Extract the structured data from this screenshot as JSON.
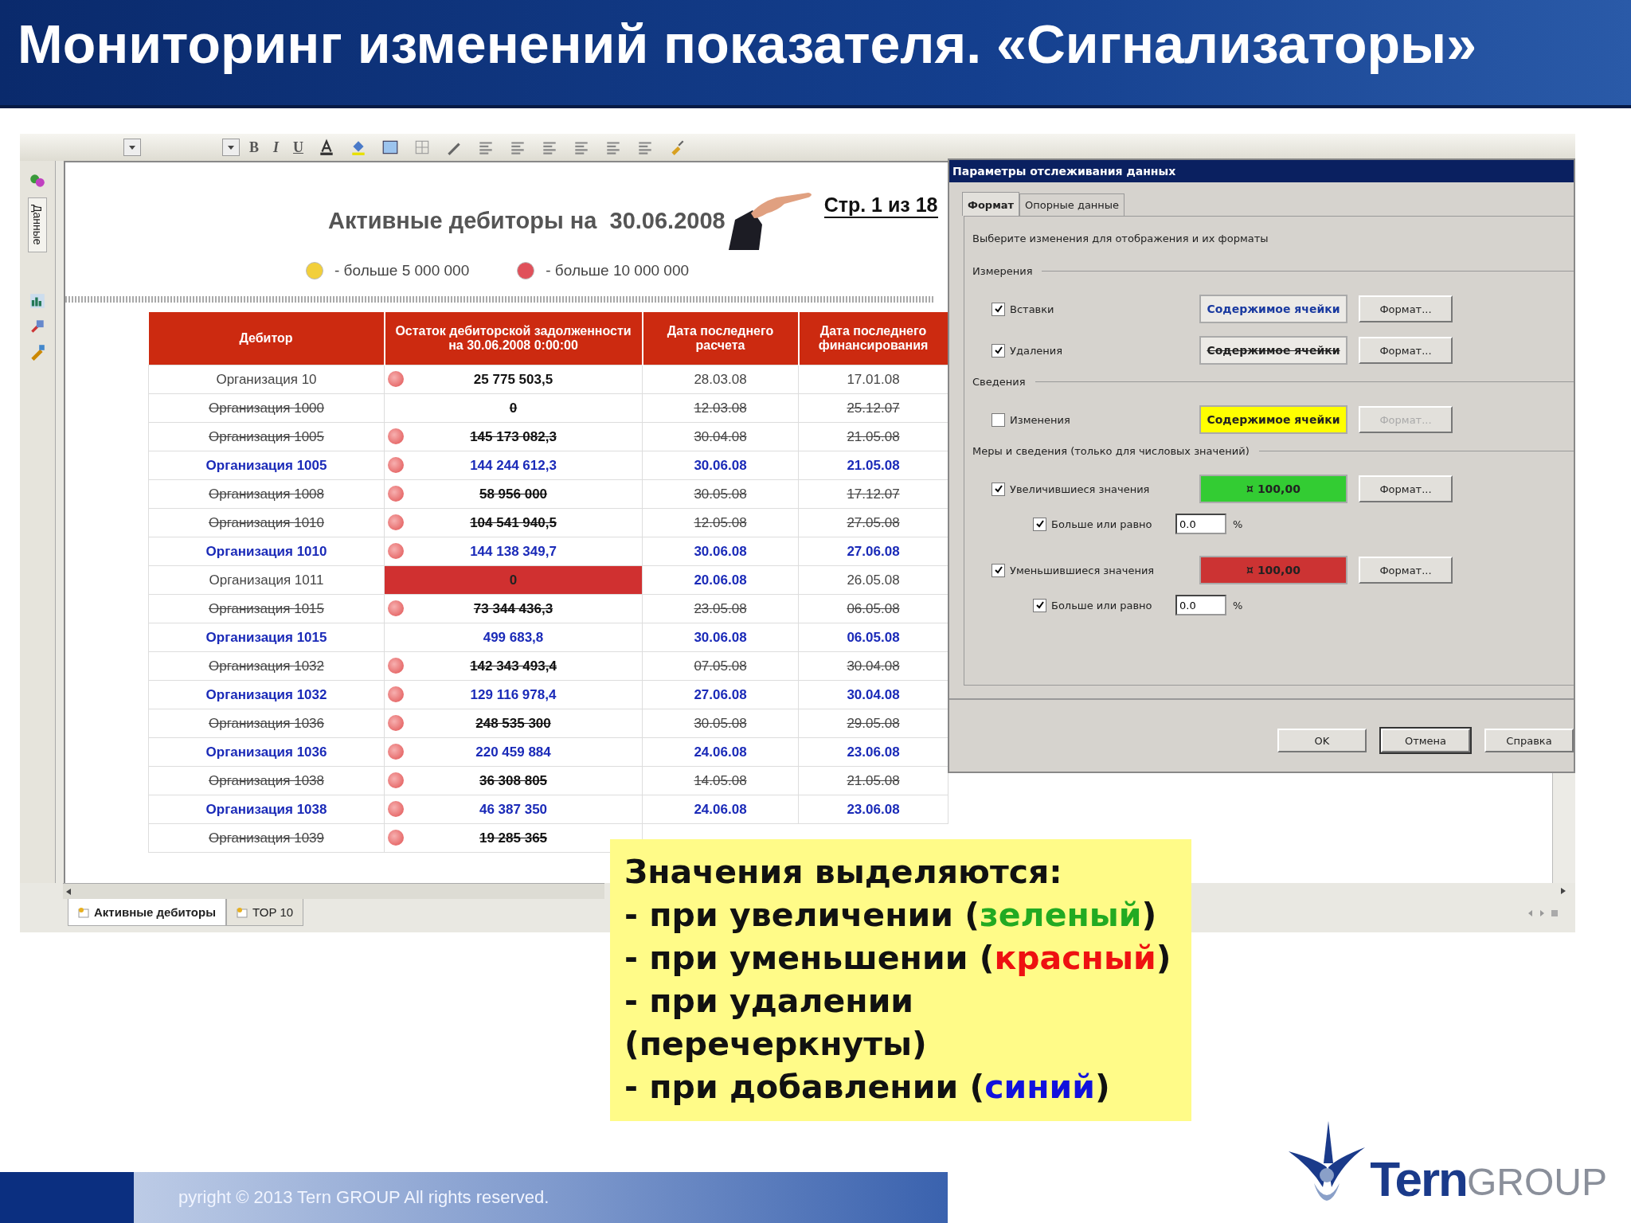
{
  "slide_title": "Мониторинг изменений показателя. «Сигнализаторы»",
  "toolbar": {
    "format_buttons": [
      "B",
      "I",
      "U"
    ]
  },
  "side_panel": {
    "tab": "Данные"
  },
  "report": {
    "title": "Активные дебиторы на  30.06.2008",
    "page": "Стр. 1 из 18",
    "legend": [
      {
        "label": "- больше 5 000 000",
        "color": "#f2cf3a"
      },
      {
        "label": "- больше 10 000 000",
        "color": "#e0505a"
      }
    ],
    "columns": [
      "Дебитор",
      "Остаток дебиторской задолженности на 30.06.2008 0:00:00",
      "Дата последнего расчета",
      "Дата последнего финансирования"
    ],
    "rows": [
      {
        "marker": true,
        "cells": [
          {
            "text": "Организация 10",
            "kind": "normal"
          },
          {
            "text": "25 775 503,5",
            "kind": "normal"
          },
          {
            "text": "28.03.08",
            "kind": "normal"
          },
          {
            "text": "17.01.08",
            "kind": "normal"
          }
        ]
      },
      {
        "marker": false,
        "cells": [
          {
            "text": "Организация 1000",
            "kind": "deleted"
          },
          {
            "text": "0",
            "kind": "deleted"
          },
          {
            "text": "12.03.08",
            "kind": "deleted"
          },
          {
            "text": "25.12.07",
            "kind": "deleted"
          }
        ]
      },
      {
        "marker": true,
        "cells": [
          {
            "text": "Организация 1005",
            "kind": "deleted"
          },
          {
            "text": "145 173 082,3",
            "kind": "deleted"
          },
          {
            "text": "30.04.08",
            "kind": "deleted"
          },
          {
            "text": "21.05.08",
            "kind": "deleted"
          }
        ]
      },
      {
        "marker": true,
        "cells": [
          {
            "text": "Организация 1005",
            "kind": "added"
          },
          {
            "text": "144 244 612,3",
            "kind": "added"
          },
          {
            "text": "30.06.08",
            "kind": "added"
          },
          {
            "text": "21.05.08",
            "kind": "added"
          }
        ]
      },
      {
        "marker": true,
        "cells": [
          {
            "text": "Организация 1008",
            "kind": "deleted"
          },
          {
            "text": "58 956 000",
            "kind": "deleted"
          },
          {
            "text": "30.05.08",
            "kind": "deleted"
          },
          {
            "text": "17.12.07",
            "kind": "deleted"
          }
        ]
      },
      {
        "marker": true,
        "cells": [
          {
            "text": "Организация 1010",
            "kind": "deleted"
          },
          {
            "text": "104 541 940,5",
            "kind": "deleted"
          },
          {
            "text": "12.05.08",
            "kind": "deleted"
          },
          {
            "text": "27.05.08",
            "kind": "deleted"
          }
        ]
      },
      {
        "marker": true,
        "cells": [
          {
            "text": "Организация 1010",
            "kind": "added"
          },
          {
            "text": "144 138 349,7",
            "kind": "added"
          },
          {
            "text": "30.06.08",
            "kind": "added"
          },
          {
            "text": "27.06.08",
            "kind": "added"
          }
        ]
      },
      {
        "marker": false,
        "cells": [
          {
            "text": "Организация 1011",
            "kind": "normal"
          },
          {
            "text": "0",
            "kind": "alert"
          },
          {
            "text": "20.06.08",
            "kind": "added"
          },
          {
            "text": "26.05.08",
            "kind": "normal"
          }
        ]
      },
      {
        "marker": true,
        "cells": [
          {
            "text": "Организация 1015",
            "kind": "deleted"
          },
          {
            "text": "73 344 436,3",
            "kind": "deleted"
          },
          {
            "text": "23.05.08",
            "kind": "deleted"
          },
          {
            "text": "06.05.08",
            "kind": "deleted"
          }
        ]
      },
      {
        "marker": false,
        "cells": [
          {
            "text": "Организация 1015",
            "kind": "added"
          },
          {
            "text": "499 683,8",
            "kind": "added"
          },
          {
            "text": "30.06.08",
            "kind": "added"
          },
          {
            "text": "06.05.08",
            "kind": "added"
          }
        ]
      },
      {
        "marker": true,
        "cells": [
          {
            "text": "Организация 1032",
            "kind": "deleted"
          },
          {
            "text": "142 343 493,4",
            "kind": "deleted"
          },
          {
            "text": "07.05.08",
            "kind": "deleted"
          },
          {
            "text": "30.04.08",
            "kind": "deleted"
          }
        ]
      },
      {
        "marker": true,
        "cells": [
          {
            "text": "Организация 1032",
            "kind": "added"
          },
          {
            "text": "129 116 978,4",
            "kind": "added"
          },
          {
            "text": "27.06.08",
            "kind": "added"
          },
          {
            "text": "30.04.08",
            "kind": "added"
          }
        ]
      },
      {
        "marker": true,
        "cells": [
          {
            "text": "Организация 1036",
            "kind": "deleted"
          },
          {
            "text": "248 535 300",
            "kind": "deleted"
          },
          {
            "text": "30.05.08",
            "kind": "deleted"
          },
          {
            "text": "29.05.08",
            "kind": "deleted"
          }
        ]
      },
      {
        "marker": true,
        "cells": [
          {
            "text": "Организация 1036",
            "kind": "added"
          },
          {
            "text": "220 459 884",
            "kind": "added"
          },
          {
            "text": "24.06.08",
            "kind": "added"
          },
          {
            "text": "23.06.08",
            "kind": "added"
          }
        ]
      },
      {
        "marker": true,
        "cells": [
          {
            "text": "Организация 1038",
            "kind": "deleted"
          },
          {
            "text": "36 308 805",
            "kind": "deleted"
          },
          {
            "text": "14.05.08",
            "kind": "deleted"
          },
          {
            "text": "21.05.08",
            "kind": "deleted"
          }
        ]
      },
      {
        "marker": true,
        "cells": [
          {
            "text": "Организация 1038",
            "kind": "added"
          },
          {
            "text": "46 387 350",
            "kind": "added"
          },
          {
            "text": "24.06.08",
            "kind": "added"
          },
          {
            "text": "23.06.08",
            "kind": "added"
          }
        ]
      },
      {
        "marker": true,
        "cells": [
          {
            "text": "Организация 1039",
            "kind": "deleted"
          },
          {
            "text": "19 285 365",
            "kind": "deleted"
          }
        ]
      }
    ]
  },
  "sheet_tabs": [
    {
      "label": "Активные дебиторы",
      "selected": true
    },
    {
      "label": "TOP 10",
      "selected": false
    }
  ],
  "dialog": {
    "title": "Параметры отслеживания данных",
    "tabs": [
      {
        "label": "Формат",
        "selected": true
      },
      {
        "label": "Опорные данные",
        "selected": false
      }
    ],
    "instruction": "Выберите изменения для отображения и их форматы",
    "sections": [
      {
        "label": "Измерения",
        "rows": [
          {
            "checked": true,
            "label": "Вставки",
            "preview": {
              "text": "Содержимое ячейки",
              "kind": "added"
            },
            "format_button": {
              "label": "Формат...",
              "disabled": false
            }
          },
          {
            "checked": true,
            "label": "Удаления",
            "preview": {
              "text": "Содержимое ячейки",
              "kind": "deleted"
            },
            "format_button": {
              "label": "Формат...",
              "disabled": false
            }
          }
        ]
      },
      {
        "label": "Сведения",
        "rows": [
          {
            "checked": false,
            "label": "Изменения",
            "preview": {
              "text": "Содержимое ячейки",
              "kind": "fill",
              "color": "#ffff00"
            },
            "format_button": {
              "label": "Формат...",
              "disabled": true
            }
          }
        ]
      },
      {
        "label": "Меры и сведения (только для числовых значений)",
        "rows": [
          {
            "checked": true,
            "label": "Увеличившиеся значения",
            "preview": {
              "text": "¤ 100,00",
              "kind": "fill",
              "color": "#33cc33"
            },
            "format_button": {
              "label": "Формат...",
              "disabled": false
            },
            "threshold": {
              "checked": true,
              "label": "Больше или равно",
              "value": "0.0",
              "unit": "%"
            }
          },
          {
            "checked": true,
            "label": "Уменьшившиеся значения",
            "preview": {
              "text": "¤ 100,00",
              "kind": "fill",
              "color": "#cc3333"
            },
            "format_button": {
              "label": "Формат...",
              "disabled": false
            },
            "threshold": {
              "checked": true,
              "label": "Больше или равно",
              "value": "0.0",
              "unit": "%"
            }
          }
        ]
      }
    ],
    "buttons": [
      {
        "label": "OK",
        "default": false
      },
      {
        "label": "Отмена",
        "default": true
      },
      {
        "label": "Справка",
        "default": false
      }
    ]
  },
  "callout": {
    "lines": [
      [
        {
          "text": "Значения выделяются:"
        }
      ],
      [
        {
          "text": "- при увеличении ("
        },
        {
          "text": "зеленый",
          "color": "#22aa22"
        },
        {
          "text": ")"
        }
      ],
      [
        {
          "text": "- при уменьшении ("
        },
        {
          "text": "красный",
          "color": "#ee1111"
        },
        {
          "text": ")"
        }
      ],
      [
        {
          "text": "- при удалении"
        }
      ],
      [
        {
          "text": "(перечеркнуты)"
        }
      ],
      [
        {
          "text": "- при добавлении ("
        },
        {
          "text": "синий",
          "color": "#1111dd"
        },
        {
          "text": ")"
        }
      ]
    ]
  },
  "footer": {
    "copyright": "pyright © 2013 Tern GROUP All rights reserved."
  },
  "logo": {
    "name": "Tern",
    "suffix": "GROUP"
  }
}
